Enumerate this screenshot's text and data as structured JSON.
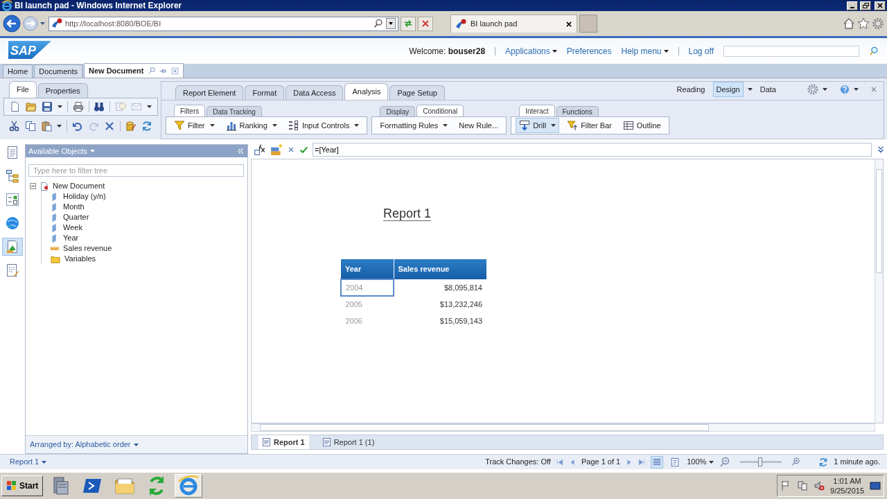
{
  "window": {
    "title": "BI launch pad - Windows Internet Explorer"
  },
  "browser": {
    "address": "http://localhost:8080/BOE/BI",
    "tabs": [
      {
        "label": "BI launch pad",
        "selected": true
      }
    ]
  },
  "header": {
    "logo": "SAP",
    "welcome_label": "Welcome:",
    "user": "bouser28",
    "links": [
      {
        "label": "Applications",
        "dropdown": true
      },
      {
        "label": "Preferences",
        "dropdown": false
      },
      {
        "label": "Help menu",
        "dropdown": true
      },
      {
        "label": "Log off",
        "dropdown": false
      }
    ]
  },
  "app_tabs": [
    {
      "label": "Home",
      "selected": false
    },
    {
      "label": "Documents",
      "selected": false
    },
    {
      "label": "New Document",
      "selected": true
    }
  ],
  "file_tabs": [
    {
      "label": "File",
      "selected": true
    },
    {
      "label": "Properties",
      "selected": false
    }
  ],
  "ribbon_tabs": [
    {
      "label": "Report Element",
      "selected": false
    },
    {
      "label": "Format",
      "selected": false
    },
    {
      "label": "Data Access",
      "selected": false
    },
    {
      "label": "Analysis",
      "selected": true
    },
    {
      "label": "Page Setup",
      "selected": false
    }
  ],
  "view_modes": [
    {
      "label": "Reading",
      "selected": false,
      "dropdown": false
    },
    {
      "label": "Design",
      "selected": true,
      "dropdown": true
    },
    {
      "label": "Data",
      "selected": false,
      "dropdown": false
    }
  ],
  "groups": [
    {
      "tabs": [
        {
          "label": "Filters",
          "selected": true
        },
        {
          "label": "Data Tracking",
          "selected": false
        }
      ],
      "items": [
        {
          "label": "Filter",
          "kind": "filter",
          "dropdown": true,
          "selected": false
        },
        {
          "label": "Ranking",
          "kind": "ranking",
          "dropdown": true,
          "selected": false
        },
        {
          "label": "Input Controls",
          "kind": "controls",
          "dropdown": true,
          "selected": false
        }
      ]
    },
    {
      "tabs": [
        {
          "label": "Display",
          "selected": false
        },
        {
          "label": "Conditional",
          "selected": true
        }
      ],
      "items": [
        {
          "label": "Formatting Rules",
          "kind": "text",
          "dropdown": true,
          "selected": false
        },
        {
          "label": "New Rule...",
          "kind": "text",
          "dropdown": false,
          "selected": false
        }
      ]
    },
    {
      "tabs": [
        {
          "label": "Interact",
          "selected": true
        },
        {
          "label": "Functions",
          "selected": false
        }
      ],
      "items": [
        {
          "label": "Drill",
          "kind": "drill",
          "dropdown": true,
          "selected": true
        },
        {
          "label": "Filter Bar",
          "kind": "filterbar",
          "dropdown": false,
          "selected": false
        },
        {
          "label": "Outline",
          "kind": "outline",
          "dropdown": false,
          "selected": false
        }
      ]
    }
  ],
  "formula": "=[Year]",
  "objects_panel": {
    "title": "Available Objects",
    "filter_placeholder": "Type here to filter tree",
    "footer": "Arranged by: Alphabetic order",
    "tree": [
      {
        "label": "New Document",
        "kind": "document",
        "expanded": true,
        "children": [
          {
            "label": "Holiday (y/n)",
            "kind": "dimension"
          },
          {
            "label": "Month",
            "kind": "dimension"
          },
          {
            "label": "Quarter",
            "kind": "dimension"
          },
          {
            "label": "Week",
            "kind": "dimension"
          },
          {
            "label": "Year",
            "kind": "dimension"
          },
          {
            "label": "Sales revenue",
            "kind": "measure"
          },
          {
            "label": "Variables",
            "kind": "folder"
          }
        ]
      }
    ]
  },
  "report": {
    "title": "Report 1",
    "table": {
      "columns": [
        "Year",
        "Sales revenue"
      ],
      "rows": [
        {
          "cells": [
            "2004",
            "$8,095,814"
          ],
          "selected": true
        },
        {
          "cells": [
            "2005",
            "$13,232,246"
          ],
          "selected": false
        },
        {
          "cells": [
            "2006",
            "$15,059,143"
          ],
          "selected": false
        }
      ]
    }
  },
  "report_tabs": [
    {
      "label": "Report 1",
      "selected": true
    },
    {
      "label": "Report 1 (1)",
      "selected": false
    }
  ],
  "status_bar": {
    "report": "Report 1",
    "track_changes": "Track Changes: Off",
    "page": "Page 1 of 1",
    "page_views": [
      {
        "kind": "draft",
        "selected": true
      },
      {
        "kind": "page",
        "selected": false
      }
    ],
    "zoom": "100%",
    "zoom_slider": {
      "level": 0.47
    },
    "refresh": "1 minute ago."
  },
  "taskbar": {
    "start": "Start",
    "apps": [
      {
        "kind": "server",
        "selected": false
      },
      {
        "kind": "shell",
        "selected": false
      },
      {
        "kind": "folder",
        "selected": false
      },
      {
        "kind": "sync",
        "selected": false
      },
      {
        "kind": "browser",
        "selected": true
      }
    ],
    "time": "1:01 AM",
    "date": "9/25/2015"
  }
}
